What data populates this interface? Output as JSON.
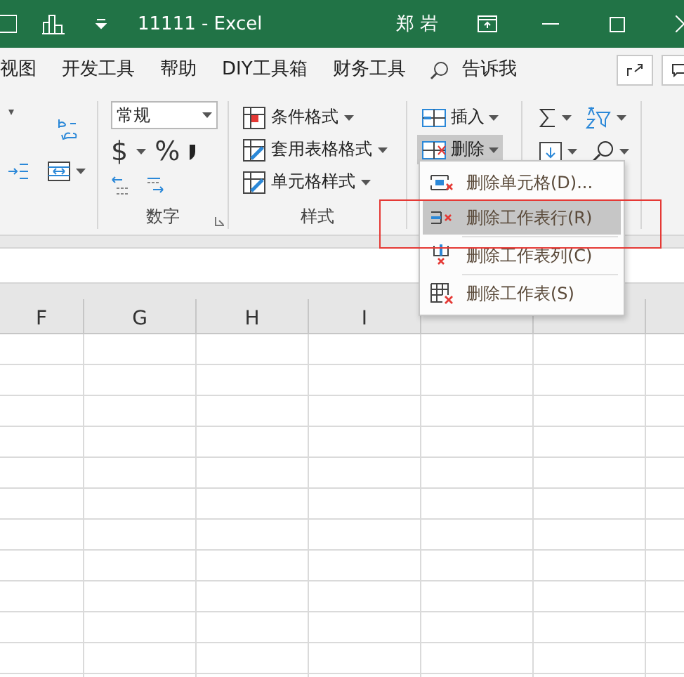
{
  "title_bar": {
    "title": "11111  -  Excel",
    "user": "郑 岩"
  },
  "menu_tabs": [
    {
      "label": "视图",
      "selected": false
    },
    {
      "label": "开发工具",
      "selected": false
    },
    {
      "label": "帮助",
      "selected": false
    },
    {
      "label": "DIY工具箱",
      "selected": false
    },
    {
      "label": "财务工具",
      "selected": false
    }
  ],
  "tell_me": "告诉我",
  "number_group": {
    "format": "常规",
    "currency": "$",
    "percent": "%",
    "label": "数字"
  },
  "styles_group": {
    "items": [
      "条件格式",
      "套用表格格式",
      "单元格样式"
    ],
    "label": "样式"
  },
  "cells_group": {
    "items": [
      {
        "label": "插入",
        "pressed": false
      },
      {
        "label": "删除",
        "pressed": true
      }
    ]
  },
  "delete_menu": {
    "items": [
      {
        "label": "删除单元格(D)...",
        "selected": false,
        "kind": "cells"
      },
      {
        "label": "删除工作表行(R)",
        "selected": true,
        "kind": "rows"
      },
      {
        "label": "删除工作表列(C)",
        "selected": false,
        "kind": "columns"
      },
      {
        "label": "删除工作表(S)",
        "selected": false,
        "kind": "sheet"
      }
    ]
  },
  "columns": [
    "F",
    "G",
    "H",
    "I"
  ]
}
